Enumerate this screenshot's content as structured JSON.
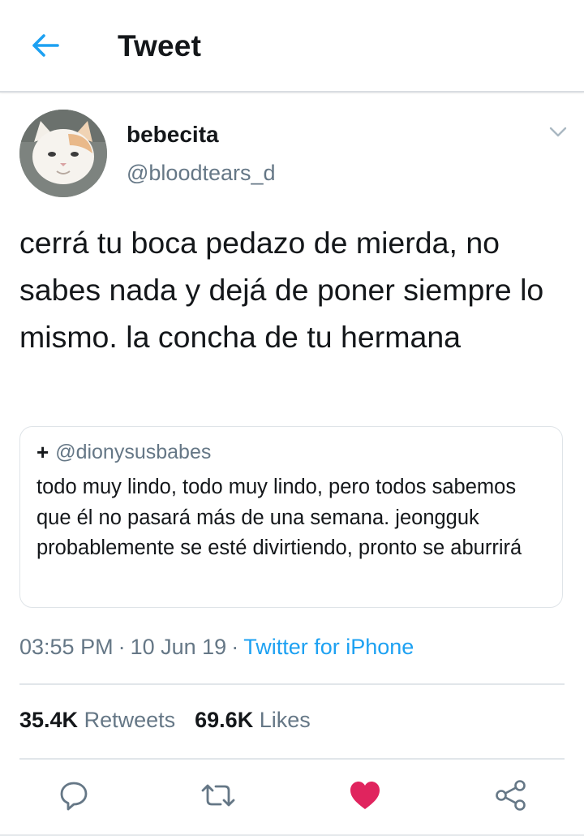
{
  "header": {
    "title": "Tweet",
    "back_icon": "arrow-left-icon",
    "accent_color": "#1da1f2"
  },
  "tweet": {
    "display_name": "bebecita",
    "handle": "@bloodtears_d",
    "text": "cerrá tu boca pedazo de mierda, no sabes nada y dejá de poner siempre lo mismo. la concha de tu hermana",
    "quote": {
      "prefix": "+",
      "handle": "@dionysusbabes",
      "text": "todo muy lindo, todo muy lindo, pero todos sabemos que él no pasará más de una semana. jeongguk probablemente se esté divirtiendo, pronto se aburrirá"
    },
    "time": "03:55 PM",
    "date": "10 Jun 19",
    "separator": "·",
    "source": "Twitter for iPhone",
    "retweets": {
      "count": "35.4K",
      "label": "Retweets"
    },
    "likes": {
      "count": "69.6K",
      "label": "Likes"
    },
    "liked": true,
    "like_color": "#e0245e"
  },
  "actions": [
    "reply-icon",
    "retweet-icon",
    "like-heart-icon",
    "share-icon"
  ]
}
